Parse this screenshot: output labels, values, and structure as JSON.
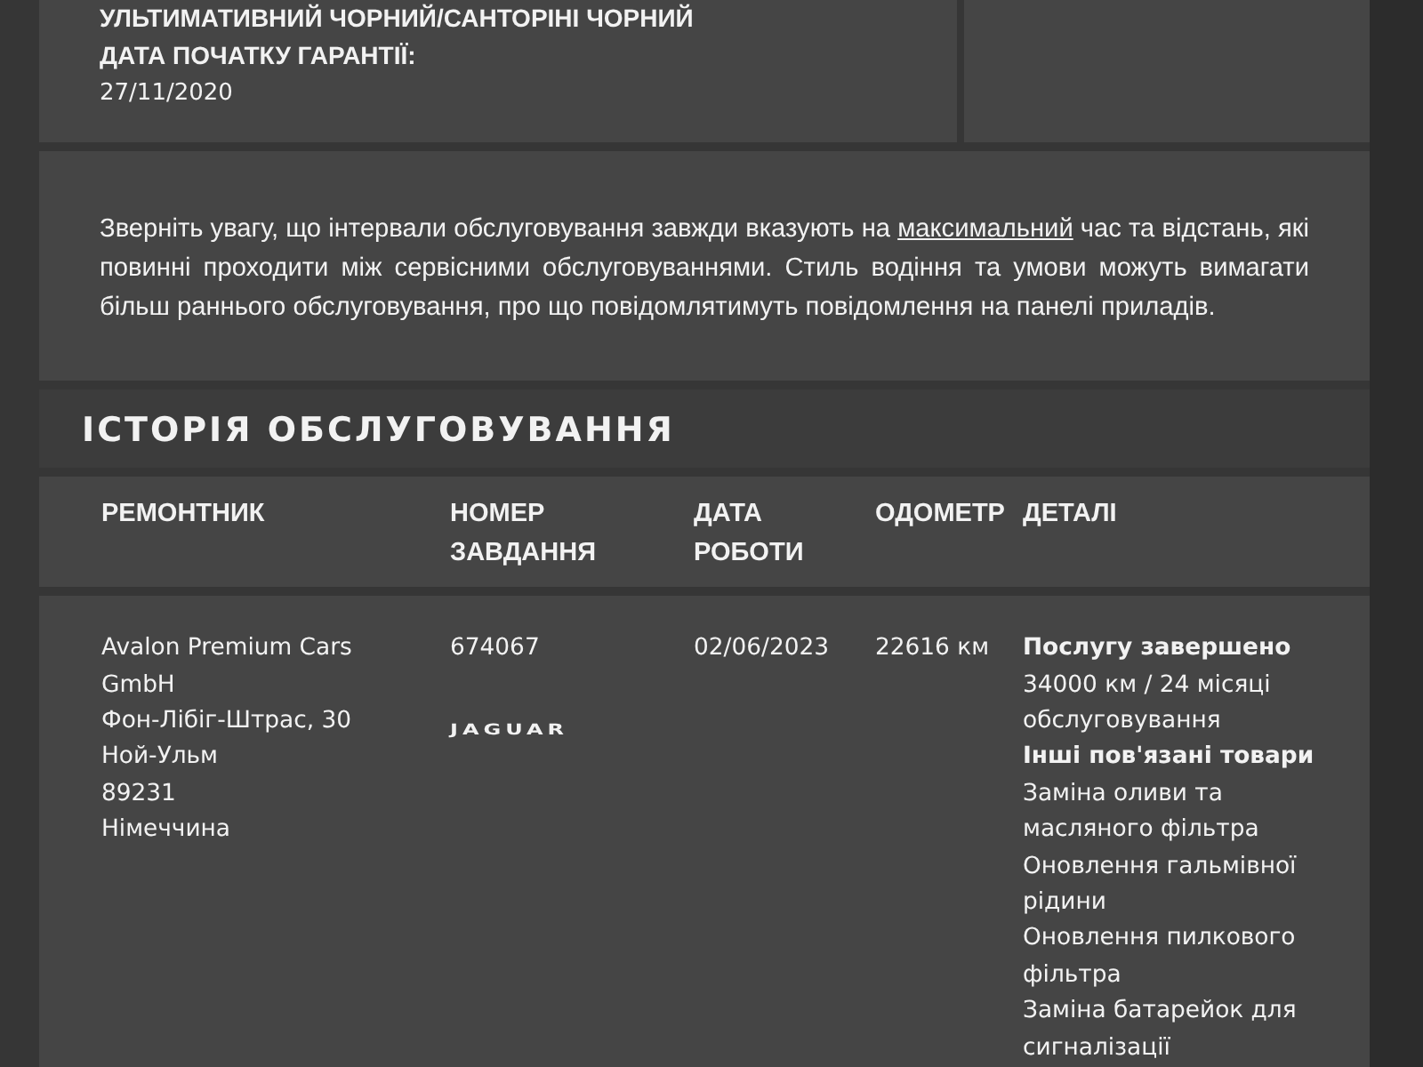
{
  "vehicle_info": {
    "color_value": "УЛЬТИМАТИВНИЙ ЧОРНИЙ/САНТОРІНІ ЧОРНИЙ",
    "warranty_label": "ДАТА ПОЧАТКУ ГАРАНТІЇ:",
    "warranty_value": "27/11/2020"
  },
  "notice": {
    "before": "Зверніть увагу, що інтервали обслуговування завжди вказують на ",
    "link": "максимальний",
    "after": " час та відстань, які повинні проходити між сервісними обслуговуваннями. Стиль водіння та умови можуть вимагати більш раннього обслуговування, про що повідомлятимуть повідомлення на панелі приладів."
  },
  "history": {
    "title": "ІСТОРІЯ ОБСЛУГОВУВАННЯ",
    "columns": [
      "РЕМОНТНИК",
      "НОМЕР ЗАВДАННЯ",
      "ДАТА РОБОТИ",
      "ОДОМЕТР",
      "ДЕТАЛІ"
    ],
    "rows": [
      {
        "dealer": [
          "Avalon Premium Cars GmbH",
          "Фон-Лібіг-Штрас, 30",
          "Ной-Ульм",
          "89231",
          "Німеччина"
        ],
        "job_number": "674067",
        "brand_logo": "JAGUAR",
        "date": "02/06/2023",
        "odometer": "22616 км",
        "details": [
          {
            "kind": "heading",
            "text": "Послугу завершено"
          },
          {
            "kind": "item",
            "text": "34000 км / 24 місяці обслуговування"
          },
          {
            "kind": "heading",
            "text": "Інші пов'язані товари"
          },
          {
            "kind": "item",
            "text": "Заміна оливи та масляного фільтра"
          },
          {
            "kind": "item",
            "text": "Оновлення гальмівної рідини"
          },
          {
            "kind": "item",
            "text": "Оновлення пилкового фільтра"
          },
          {
            "kind": "item",
            "text": "Заміна батарейок для сигналізації"
          }
        ]
      }
    ]
  }
}
